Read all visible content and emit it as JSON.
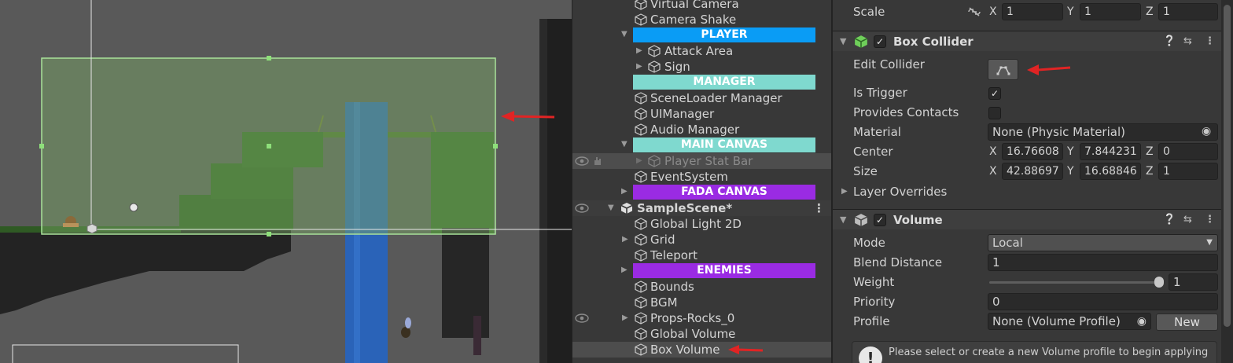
{
  "hierarchy": {
    "items": [
      {
        "kind": "object",
        "label": "Virtual Camera"
      },
      {
        "kind": "object",
        "label": "Camera Shake"
      },
      {
        "kind": "header",
        "label": "PLAYER",
        "color": "#0a9cf5"
      },
      {
        "kind": "object",
        "label": "Attack Area"
      },
      {
        "kind": "object",
        "label": "Sign"
      },
      {
        "kind": "header",
        "label": "MANAGER",
        "color": "#7fd9cf"
      },
      {
        "kind": "object",
        "label": "SceneLoader Manager"
      },
      {
        "kind": "object",
        "label": "UIManager"
      },
      {
        "kind": "object",
        "label": "Audio Manager"
      },
      {
        "kind": "header",
        "label": "MAIN CANVAS",
        "color": "#7fd9cf"
      },
      {
        "kind": "object",
        "label": "Player Stat Bar",
        "hidden": true
      },
      {
        "kind": "object",
        "label": "EventSystem"
      },
      {
        "kind": "header",
        "label": "FADA CANVAS",
        "color": "#9a2be3"
      },
      {
        "kind": "scene",
        "label": "SampleScene*"
      },
      {
        "kind": "object",
        "label": "Global Light 2D"
      },
      {
        "kind": "object",
        "label": "Grid"
      },
      {
        "kind": "object",
        "label": "Teleport"
      },
      {
        "kind": "header",
        "label": "ENEMIES",
        "color": "#9a2be3"
      },
      {
        "kind": "object",
        "label": "Bounds"
      },
      {
        "kind": "object",
        "label": "BGM"
      },
      {
        "kind": "object",
        "label": "Props-Rocks_0"
      },
      {
        "kind": "object",
        "label": "Global Volume"
      },
      {
        "kind": "object",
        "label": "Box Volume",
        "selected": true
      }
    ]
  },
  "inspector": {
    "transform": {
      "scale_label": "Scale",
      "scale_x": "1",
      "scale_y": "1",
      "scale_z": "1"
    },
    "box_collider": {
      "title": "Box Collider",
      "enabled": true,
      "edit_collider_label": "Edit Collider",
      "is_trigger_label": "Is Trigger",
      "is_trigger": true,
      "provides_contacts_label": "Provides Contacts",
      "provides_contacts": false,
      "material_label": "Material",
      "material_value": "None (Physic Material)",
      "center_label": "Center",
      "center_x": "16.76608",
      "center_y": "7.844231",
      "center_z": "0",
      "size_label": "Size",
      "size_x": "42.88697",
      "size_y": "16.68846",
      "size_z": "1",
      "layer_overrides_label": "Layer Overrides"
    },
    "volume": {
      "title": "Volume",
      "enabled": true,
      "mode_label": "Mode",
      "mode_value": "Local",
      "blend_distance_label": "Blend Distance",
      "blend_distance_value": "1",
      "weight_label": "Weight",
      "weight_value": "1",
      "weight_fraction": 1.0,
      "priority_label": "Priority",
      "priority_value": "0",
      "profile_label": "Profile",
      "profile_value": "None (Volume Profile)",
      "new_button": "New"
    },
    "help_text": "Please select or create a new Volume profile to begin applying"
  },
  "axes": {
    "x": "X",
    "y": "Y",
    "z": "Z"
  },
  "colors": {
    "annotation_arrow": "#e02424",
    "collider_fill": "#6f9a5a"
  }
}
